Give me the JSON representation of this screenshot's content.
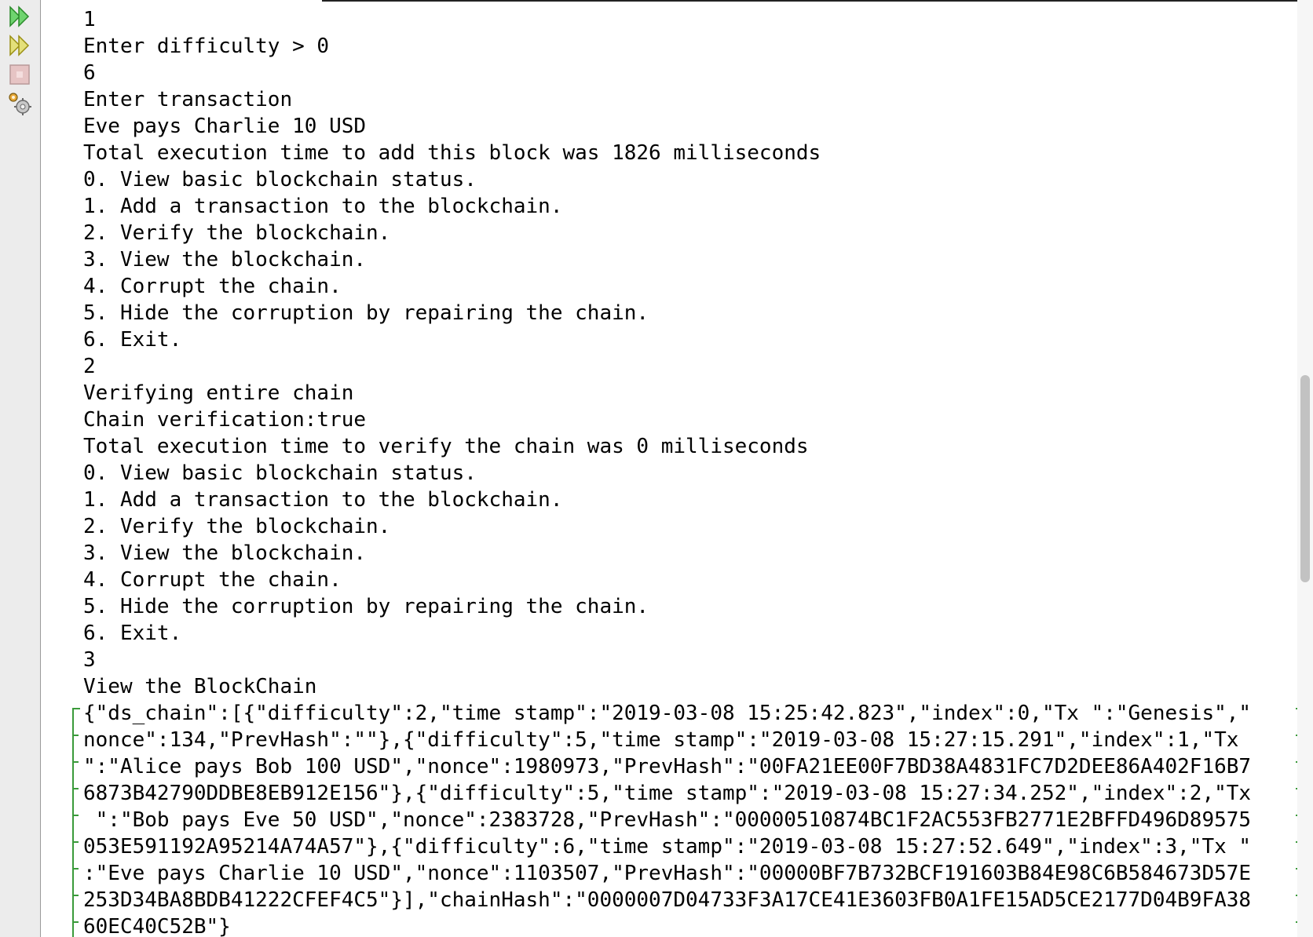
{
  "toolbar": {
    "buttons": [
      {
        "icon": "rerun-icon"
      },
      {
        "icon": "rerun-with-different-parameters-icon"
      },
      {
        "icon": "stop-icon"
      },
      {
        "icon": "settings-icon"
      }
    ]
  },
  "console": {
    "lines": [
      "1",
      "Enter difficulty > 0",
      "6",
      "Enter transaction",
      "Eve pays Charlie 10 USD",
      "Total execution time to add this block was 1826 milliseconds",
      "0. View basic blockchain status.",
      "1. Add a transaction to the blockchain.",
      "2. Verify the blockchain.",
      "3. View the blockchain.",
      "4. Corrupt the chain.",
      "5. Hide the corruption by repairing the chain.",
      "6. Exit.",
      "2",
      "Verifying entire chain",
      "Chain verification:true",
      "Total execution time to verify the chain was 0 milliseconds",
      "0. View basic blockchain status.",
      "1. Add a transaction to the blockchain.",
      "2. Verify the blockchain.",
      "3. View the blockchain.",
      "4. Corrupt the chain.",
      "5. Hide the corruption by repairing the chain.",
      "6. Exit.",
      "3",
      "View the BlockChain"
    ],
    "json_lines": [
      "{\"ds_chain\":[{\"difficulty\":2,\"time stamp\":\"2019-03-08 15:25:42.823\",\"index\":0,\"Tx \":\"Genesis\",\"",
      "nonce\":134,\"PrevHash\":\"\"},{\"difficulty\":5,\"time stamp\":\"2019-03-08 15:27:15.291\",\"index\":1,\"Tx",
      "\":\"Alice pays Bob 100 USD\",\"nonce\":1980973,\"PrevHash\":\"00FA21EE00F7BD38A4831FC7D2DEE86A402F16B7",
      "6873B42790DDBE8EB912E156\"},{\"difficulty\":5,\"time stamp\":\"2019-03-08 15:27:34.252\",\"index\":2,\"Tx",
      " \":\"Bob pays Eve 50 USD\",\"nonce\":2383728,\"PrevHash\":\"00000510874BC1F2AC553FB2771E2BFFD496D89575",
      "053E591192A95214A74A57\"},{\"difficulty\":6,\"time stamp\":\"2019-03-08 15:27:52.649\",\"index\":3,\"Tx \"",
      ":\"Eve pays Charlie 10 USD\",\"nonce\":1103507,\"PrevHash\":\"00000BF7B732BCF191603B84E98C6B584673D57E",
      "253D34BA8BDB41222CFEF4C5\"}],\"chainHash\":\"0000007D04733F3A17CE41E3603FB0A1FE15AD5CE2177D04B9FA38",
      "60EC40C52B\"}"
    ]
  },
  "colors": {
    "fold_marker": "#3a9a3a",
    "run_icon": "#2fa82f",
    "rerun_icon": "#c8b400",
    "stop_icon": "#d29898"
  }
}
